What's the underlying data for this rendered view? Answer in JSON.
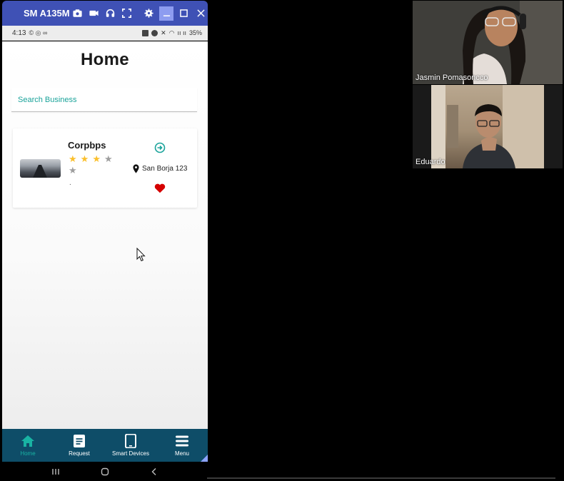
{
  "mirror_window": {
    "device_name": "SM A135M",
    "toolbar_icons": [
      "camera-icon",
      "video-icon",
      "headset-icon",
      "fullscreen-icon",
      "gear-icon"
    ],
    "window_controls": [
      "minimize-icon",
      "maximize-icon",
      "close-icon"
    ]
  },
  "status_bar": {
    "time": "4:13",
    "left_icons": "© ◎ ∞",
    "signal_text": "ıı ıı",
    "battery": "35%"
  },
  "app": {
    "title": "Home",
    "search_placeholder": "Search Business",
    "business": {
      "name": "Corpbps",
      "rating": 3,
      "rating_max": 5,
      "detail": ".",
      "location": "San Borja 123",
      "favorite": true
    }
  },
  "bottom_nav": {
    "items": [
      {
        "label": "Home",
        "icon": "home-icon",
        "active": true
      },
      {
        "label": "Request",
        "icon": "document-icon",
        "active": false
      },
      {
        "label": "Smart Devices",
        "icon": "tablet-icon",
        "active": false
      },
      {
        "label": "Menu",
        "icon": "hamburger-icon",
        "active": false
      }
    ]
  },
  "participants": [
    {
      "name": "Jasmin Pomasoncco"
    },
    {
      "name": "Eduardo"
    }
  ],
  "colors": {
    "titlebar": "#3f51b5",
    "accent": "#1aa39a",
    "star": "#fbc02d",
    "heart": "#d50000",
    "bottom_nav": "#0e4d68"
  }
}
